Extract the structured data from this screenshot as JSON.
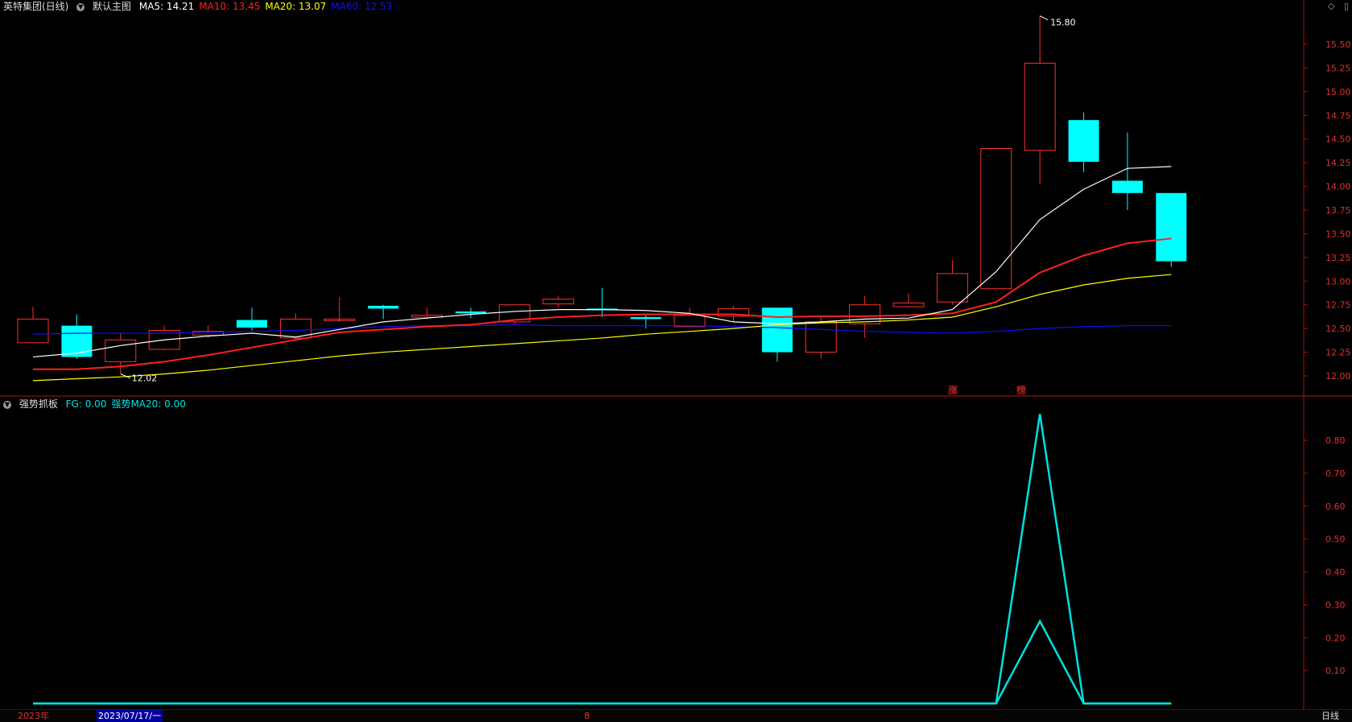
{
  "header": {
    "stock_title": "英特集团(日线)",
    "chart_template": "默认主图",
    "ma_labels": [
      {
        "text": "MA5: 14.21",
        "color": "#ffffff"
      },
      {
        "text": "MA10: 13.45",
        "color": "#ff2020"
      },
      {
        "text": "MA20: 13.07",
        "color": "#ffff00"
      },
      {
        "text": "MA60: 12.53",
        "color": "#1010ff"
      }
    ]
  },
  "indicator_header": {
    "name": "强势抓板",
    "values": [
      {
        "text": "FG: 0.00",
        "color": "#00e0e0"
      },
      {
        "text": "强势MA20: 0.00",
        "color": "#00e0e0"
      }
    ]
  },
  "annotations": {
    "high_label": "15.80",
    "low_label": "12.02",
    "tag_zhang": "涨",
    "tag_bang": "榜"
  },
  "bottom_bar": {
    "year_label": "2023年",
    "date_label": "2023/07/17/一",
    "month_label": "8",
    "period_label": "日线"
  },
  "icons": [
    "diamond-icon",
    "panel-toggle-icon",
    "collapse-circle-icon"
  ],
  "colors": {
    "background": "#000000",
    "up": "#ff3030",
    "down": "#00ffff",
    "axis": "#b01010",
    "ma5": "#ffffff",
    "ma10": "#ff2020",
    "ma20": "#ffff00",
    "ma60": "#1010ff",
    "indicator": "#00e0e0"
  },
  "chart_data": [
    {
      "type": "candlestick",
      "title": "英特集团(日线)",
      "ylim": [
        11.85,
        15.95
      ],
      "y_ticks": [
        "12.00",
        "12.25",
        "12.50",
        "12.75",
        "13.00",
        "13.25",
        "13.50",
        "13.75",
        "14.00",
        "14.25",
        "14.50",
        "14.75",
        "15.00",
        "15.25",
        "15.50"
      ],
      "candles": [
        {
          "o": 12.35,
          "h": 12.73,
          "l": 12.35,
          "c": 12.6
        },
        {
          "o": 12.53,
          "h": 12.65,
          "l": 12.18,
          "c": 12.2
        },
        {
          "o": 12.15,
          "h": 12.45,
          "l": 12.02,
          "c": 12.38
        },
        {
          "o": 12.28,
          "h": 12.53,
          "l": 12.27,
          "c": 12.48
        },
        {
          "o": 12.43,
          "h": 12.53,
          "l": 12.4,
          "c": 12.47
        },
        {
          "o": 12.59,
          "h": 12.72,
          "l": 12.48,
          "c": 12.51
        },
        {
          "o": 12.4,
          "h": 12.66,
          "l": 12.38,
          "c": 12.6
        },
        {
          "o": 12.6,
          "h": 12.83,
          "l": 12.57,
          "c": 12.6
        },
        {
          "o": 12.74,
          "h": 12.75,
          "l": 12.6,
          "c": 12.71
        },
        {
          "o": 12.62,
          "h": 12.72,
          "l": 12.6,
          "c": 12.64
        },
        {
          "o": 12.68,
          "h": 12.72,
          "l": 12.61,
          "c": 12.66
        },
        {
          "o": 12.57,
          "h": 12.75,
          "l": 12.55,
          "c": 12.75
        },
        {
          "o": 12.76,
          "h": 12.84,
          "l": 12.72,
          "c": 12.81
        },
        {
          "o": 12.71,
          "h": 12.93,
          "l": 12.62,
          "c": 12.7
        },
        {
          "o": 12.62,
          "h": 12.64,
          "l": 12.5,
          "c": 12.6
        },
        {
          "o": 12.52,
          "h": 12.72,
          "l": 12.52,
          "c": 12.64
        },
        {
          "o": 12.63,
          "h": 12.74,
          "l": 12.57,
          "c": 12.71
        },
        {
          "o": 12.72,
          "h": 12.72,
          "l": 12.15,
          "c": 12.25
        },
        {
          "o": 12.25,
          "h": 12.62,
          "l": 12.18,
          "c": 12.57
        },
        {
          "o": 12.55,
          "h": 12.84,
          "l": 12.4,
          "c": 12.75
        },
        {
          "o": 12.73,
          "h": 12.87,
          "l": 12.72,
          "c": 12.77
        },
        {
          "o": 12.78,
          "h": 13.22,
          "l": 12.75,
          "c": 13.08
        },
        {
          "o": 12.92,
          "h": 14.4,
          "l": 12.92,
          "c": 14.4
        },
        {
          "o": 14.38,
          "h": 15.8,
          "l": 14.02,
          "c": 15.3
        },
        {
          "o": 14.7,
          "h": 14.78,
          "l": 14.15,
          "c": 14.26
        },
        {
          "o": 14.06,
          "h": 14.57,
          "l": 13.75,
          "c": 13.93
        },
        {
          "o": 13.93,
          "h": 13.93,
          "l": 13.15,
          "c": 13.21
        }
      ],
      "ma5": [
        12.2,
        12.24,
        12.32,
        12.38,
        12.42,
        12.45,
        12.41,
        12.49,
        12.57,
        12.61,
        12.65,
        12.68,
        12.7,
        12.7,
        12.69,
        12.66,
        12.57,
        12.55,
        12.57,
        12.6,
        12.61,
        12.7,
        13.1,
        13.65,
        13.97,
        14.19,
        14.21
      ],
      "ma10": [
        12.07,
        12.07,
        12.1,
        12.15,
        12.22,
        12.3,
        12.38,
        12.46,
        12.49,
        12.52,
        12.54,
        12.59,
        12.62,
        12.64,
        12.65,
        12.65,
        12.65,
        12.62,
        12.63,
        12.63,
        12.64,
        12.66,
        12.78,
        13.09,
        13.27,
        13.4,
        13.45
      ],
      "ma20": [
        11.95,
        11.97,
        11.99,
        12.02,
        12.06,
        12.11,
        12.16,
        12.21,
        12.25,
        12.28,
        12.31,
        12.34,
        12.37,
        12.4,
        12.44,
        12.47,
        12.5,
        12.54,
        12.56,
        12.57,
        12.59,
        12.62,
        12.73,
        12.86,
        12.96,
        13.03,
        13.07
      ],
      "ma60": [
        12.44,
        12.45,
        12.45,
        12.45,
        12.46,
        12.47,
        12.48,
        12.5,
        12.52,
        12.53,
        12.53,
        12.54,
        12.53,
        12.53,
        12.53,
        12.53,
        12.52,
        12.51,
        12.49,
        12.47,
        12.46,
        12.45,
        12.47,
        12.5,
        12.52,
        12.53,
        12.53
      ]
    },
    {
      "type": "line",
      "title": "强势抓板",
      "ylim": [
        0,
        0.9
      ],
      "y_ticks": [
        "0.10",
        "0.20",
        "0.30",
        "0.40",
        "0.50",
        "0.60",
        "0.70",
        "0.80"
      ],
      "series": [
        {
          "name": "FG",
          "values": [
            0,
            0,
            0,
            0,
            0,
            0,
            0,
            0,
            0,
            0,
            0,
            0,
            0,
            0,
            0,
            0,
            0,
            0,
            0,
            0,
            0,
            0,
            0,
            0.88,
            0,
            0,
            0
          ]
        },
        {
          "name": "强势MA20",
          "values": [
            0,
            0,
            0,
            0,
            0,
            0,
            0,
            0,
            0,
            0,
            0,
            0,
            0,
            0,
            0,
            0,
            0,
            0,
            0,
            0,
            0,
            0,
            0,
            0.25,
            0,
            0,
            0
          ]
        }
      ]
    }
  ]
}
